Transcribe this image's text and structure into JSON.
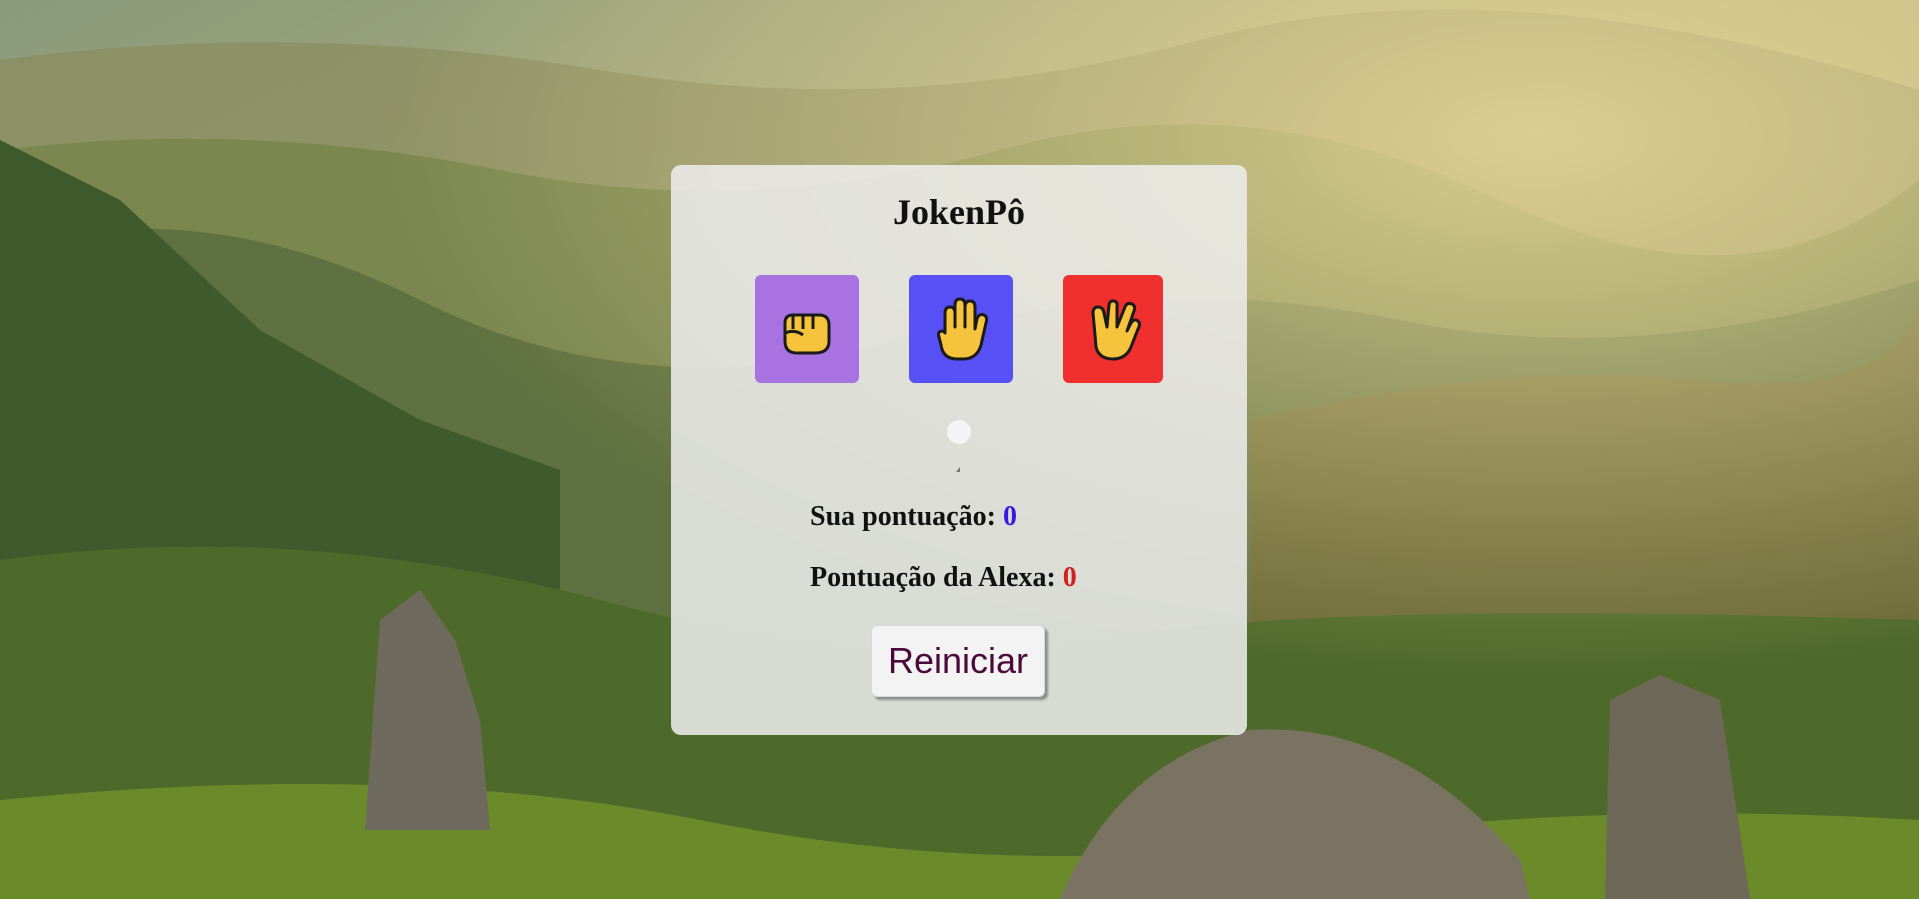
{
  "game": {
    "title": "JokenPô",
    "choices": [
      {
        "name": "pedra",
        "icon": "fist-icon",
        "color": "#a873e0"
      },
      {
        "name": "papel",
        "icon": "raised-hand-icon",
        "color": "#5650f5"
      },
      {
        "name": "spock",
        "icon": "vulcan-salute-icon",
        "color": "#f02f2f"
      }
    ],
    "player_score_label": "Sua pontuação:",
    "player_score": "0",
    "player_score_color": "#3b17e6",
    "cpu_score_label": "Pontuação da Alexa:",
    "cpu_score": "0",
    "cpu_score_color": "#d02020",
    "reset_label": "Reiniciar"
  }
}
